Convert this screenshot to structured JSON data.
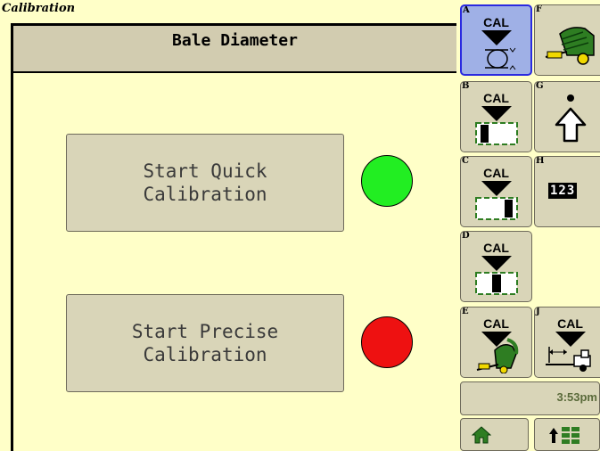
{
  "window": {
    "title": "Calibration"
  },
  "header": {
    "title": "Bale Diameter"
  },
  "actions": [
    {
      "label": "Start Quick\nCalibration",
      "status_color": "#22EE22"
    },
    {
      "label": "Start Precise\nCalibration",
      "status_color": "#EE1111"
    }
  ],
  "softkeys": {
    "A": {
      "letter": "A",
      "label": "CAL",
      "icon": "cal-diameter-icon"
    },
    "B": {
      "letter": "B",
      "label": "CAL",
      "icon": "cal-left-sensor-icon"
    },
    "C": {
      "letter": "C",
      "label": "CAL",
      "icon": "cal-right-sensor-icon"
    },
    "D": {
      "letter": "D",
      "label": "CAL",
      "icon": "cal-center-sensor-icon"
    },
    "E": {
      "letter": "E",
      "label": "CAL",
      "icon": "cal-baler-gate-icon"
    },
    "F": {
      "letter": "F",
      "icon": "baler-icon"
    },
    "G": {
      "letter": "G",
      "icon": "up-arrow-icon"
    },
    "H": {
      "letter": "H",
      "label": "123",
      "icon": "numeric-icon"
    },
    "J": {
      "letter": "J",
      "label": "CAL",
      "icon": "cal-tractor-hitch-icon"
    }
  },
  "status": {
    "time": "3:53pm"
  },
  "nav": {
    "home_icon": "home-icon",
    "menu_icon": "menu-grid-icon"
  },
  "colors": {
    "background": "#FFFFC8",
    "button": "#D9D5B8",
    "active_softkey": "#9FB0E6",
    "accent_green": "#2E7D22"
  }
}
